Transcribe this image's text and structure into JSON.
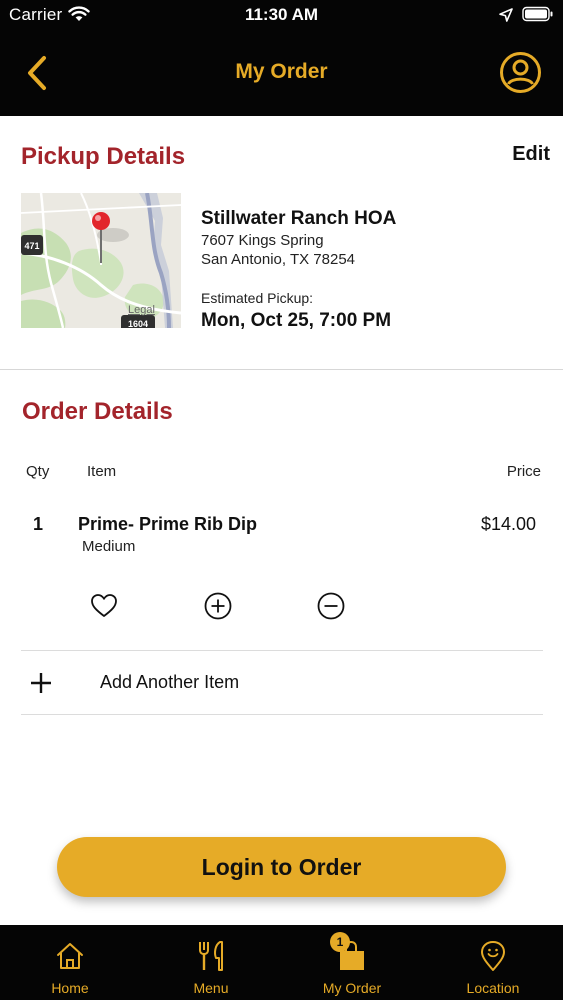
{
  "status_bar": {
    "carrier": "Carrier",
    "time": "11:30 AM",
    "icons": [
      "wifi-icon",
      "location-arrow-icon",
      "battery-icon"
    ]
  },
  "header": {
    "title": "My Order",
    "back_icon": "chevron-left-icon",
    "profile_icon": "user-circle-icon"
  },
  "pickup": {
    "title": "Pickup Details",
    "edit_label": "Edit",
    "map": {
      "highway_shields": [
        "471",
        "1604"
      ],
      "legal_label": "Legal"
    },
    "location_name": "Stillwater Ranch HOA",
    "address_line1": "7607 Kings Spring",
    "address_line2": "San Antonio, TX 78254",
    "estimated_label": "Estimated Pickup:",
    "estimated_value": "Mon, Oct 25, 7:00 PM"
  },
  "order": {
    "title": "Order Details",
    "columns": {
      "qty": "Qty",
      "item": "Item",
      "price": "Price"
    },
    "items": [
      {
        "qty": "1",
        "name": "Prime- Prime Rib Dip",
        "modifier": "Medium",
        "price": "$14.00",
        "actions": [
          "heart-icon",
          "plus-circle-icon",
          "minus-circle-icon"
        ]
      }
    ],
    "add_item_label": "Add Another Item"
  },
  "login_button_label": "Login to Order",
  "tabbar": {
    "tabs": [
      {
        "label": "Home",
        "icon": "home-icon"
      },
      {
        "label": "Menu",
        "icon": "fork-knife-icon"
      },
      {
        "label": "My Order",
        "icon": "shopping-bag-icon",
        "badge": "1",
        "active": true
      },
      {
        "label": "Location",
        "icon": "map-pin-smile-icon"
      }
    ]
  },
  "colors": {
    "accent": "#e6ab27",
    "section_title": "#a3242b",
    "bars": "#050505"
  }
}
